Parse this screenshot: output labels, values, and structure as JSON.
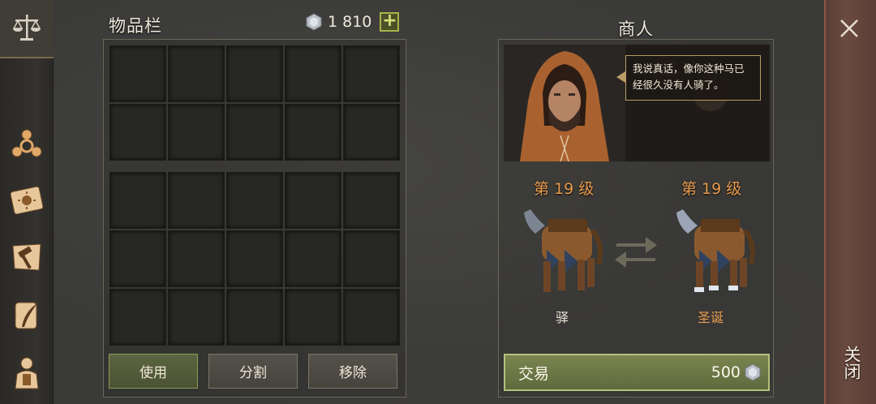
{
  "inventory": {
    "title": "物品栏",
    "currency_amount": "1 810",
    "add_label": "+",
    "buttons": {
      "use": "使用",
      "split": "分割",
      "remove": "移除"
    }
  },
  "merchant": {
    "title": "商人",
    "speech": "我说真话，像你这种马已经很久没有人骑了。",
    "left_mount": {
      "level": "第 19 级",
      "name": "驿",
      "name_color": "#e8e2d4"
    },
    "right_mount": {
      "level": "第 19 级",
      "name": "圣诞",
      "name_color": "#e79a4c"
    },
    "trade": {
      "label": "交易",
      "price": "500"
    }
  },
  "close": {
    "label": "关闭",
    "icon": "close-icon"
  },
  "rail_icons": [
    "balance-scale-icon",
    "group-icon",
    "sun-book-icon",
    "hammer-map-icon",
    "quill-scroll-icon",
    "character-icon"
  ],
  "colors": {
    "accent_green": "#8c9a56",
    "level_orange": "#e79a4c",
    "close_red": "#6a4a40"
  }
}
